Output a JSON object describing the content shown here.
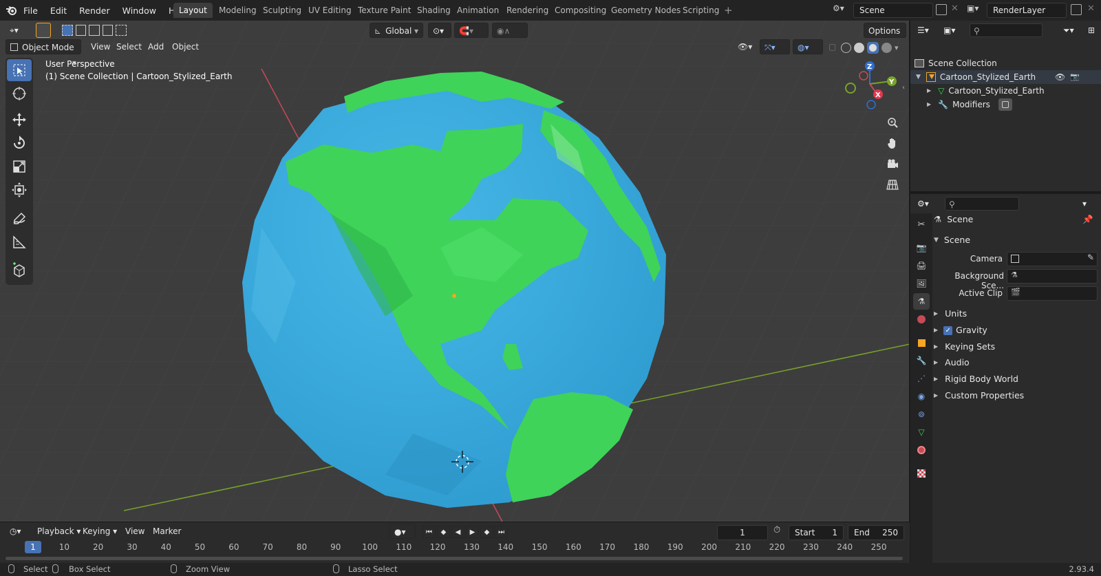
{
  "app": {
    "menus": [
      "File",
      "Edit",
      "Render",
      "Window",
      "Help"
    ],
    "workspaces": [
      "Layout",
      "Modeling",
      "Sculpting",
      "UV Editing",
      "Texture Paint",
      "Shading",
      "Animation",
      "Rendering",
      "Compositing",
      "Geometry Nodes",
      "Scripting"
    ],
    "active_workspace": "Layout",
    "scene_name": "Scene",
    "view_layer": "RenderLayer",
    "version": "2.93.4"
  },
  "viewport": {
    "mode": "Object Mode",
    "menus": [
      "View",
      "Select",
      "Add",
      "Object"
    ],
    "transform_orientation": "Global",
    "options_label": "Options",
    "overlay_line1": "User Perspective",
    "overlay_line2": "(1) Scene Collection | Cartoon_Stylized_Earth",
    "gizmo_axes": {
      "x": "X",
      "y": "Y",
      "z": "Z"
    },
    "colors": {
      "ocean": "#35a9dc",
      "land": "#3fd35a",
      "x_axis": "#c64a58",
      "y_axis": "#7aa32a"
    }
  },
  "timeline": {
    "menus": [
      "Playback",
      "Keying",
      "View",
      "Marker"
    ],
    "current_frame": "1",
    "start_label": "Start",
    "start_value": "1",
    "end_label": "End",
    "end_value": "250",
    "ticks": [
      "1",
      "10",
      "20",
      "30",
      "40",
      "50",
      "60",
      "70",
      "80",
      "90",
      "100",
      "110",
      "120",
      "130",
      "140",
      "150",
      "160",
      "170",
      "180",
      "190",
      "200",
      "210",
      "220",
      "230",
      "240",
      "250"
    ]
  },
  "statusbar": {
    "select": "Select",
    "box_select": "Box Select",
    "zoom_view": "Zoom View",
    "lasso_select": "Lasso Select"
  },
  "outliner": {
    "root": "Scene Collection",
    "object": "Cartoon_Stylized_Earth",
    "mesh": "Cartoon_Stylized_Earth",
    "modifiers": "Modifiers"
  },
  "properties": {
    "context": "Scene",
    "panel_title": "Scene",
    "camera_label": "Camera",
    "background_label": "Background Sce...",
    "active_clip_label": "Active Clip",
    "sections": [
      "Units",
      "Gravity",
      "Keying Sets",
      "Audio",
      "Rigid Body World",
      "Custom Properties"
    ],
    "gravity_enabled": true
  }
}
